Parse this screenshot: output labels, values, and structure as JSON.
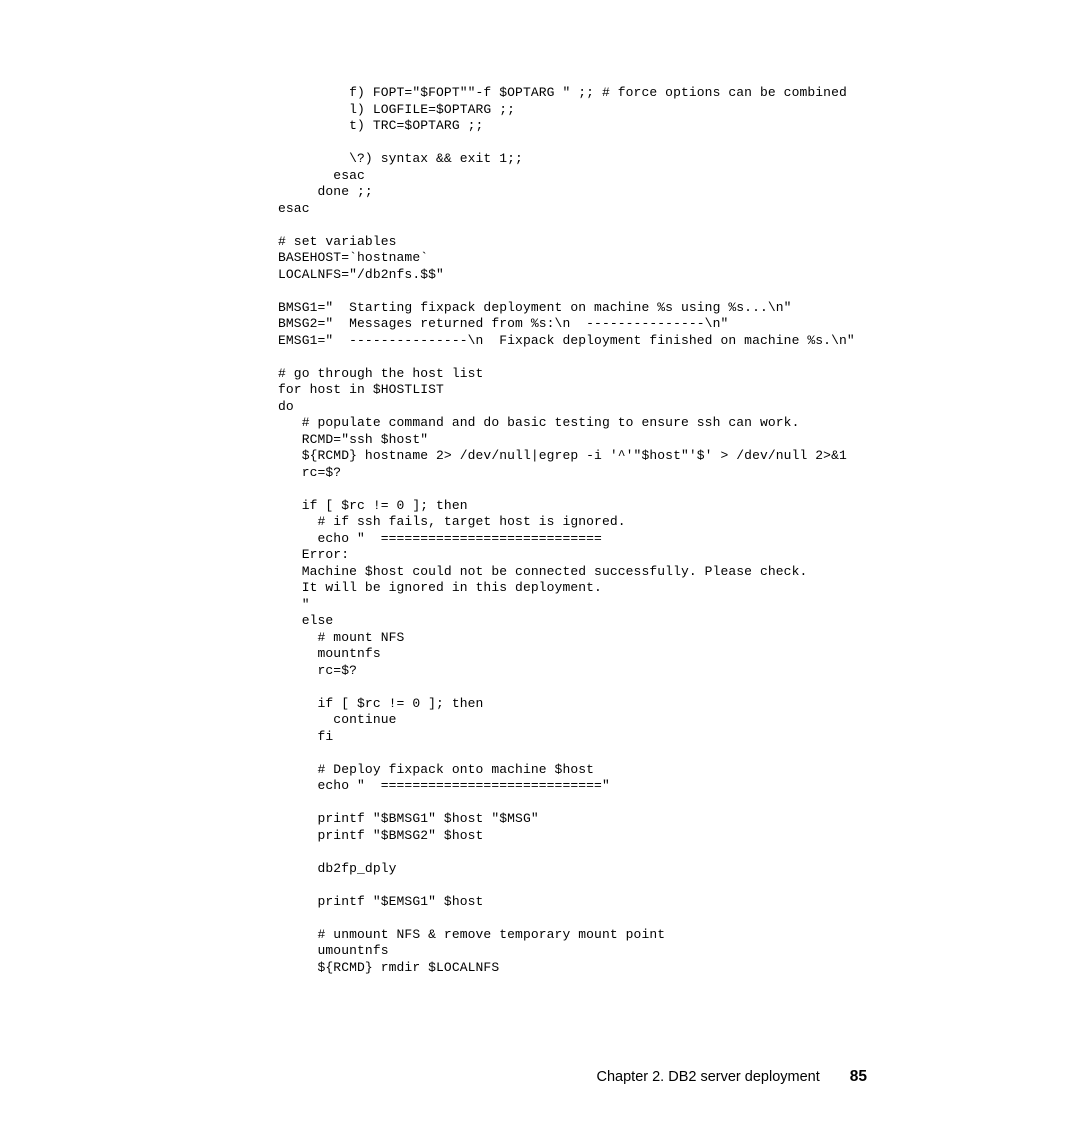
{
  "code": {
    "lines": [
      "         f) FOPT=\"$FOPT\"\"-f $OPTARG \" ;; # force options can be combined",
      "         l) LOGFILE=$OPTARG ;;",
      "         t) TRC=$OPTARG ;;",
      "",
      "         \\?) syntax && exit 1;;",
      "       esac",
      "     done ;;",
      "esac",
      "",
      "# set variables",
      "BASEHOST=`hostname`",
      "LOCALNFS=\"/db2nfs.$$\"",
      "",
      "BMSG1=\"  Starting fixpack deployment on machine %s using %s...\\n\"",
      "BMSG2=\"  Messages returned from %s:\\n  ---------------\\n\"",
      "EMSG1=\"  ---------------\\n  Fixpack deployment finished on machine %s.\\n\"",
      "",
      "# go through the host list",
      "for host in $HOSTLIST",
      "do",
      "   # populate command and do basic testing to ensure ssh can work.",
      "   RCMD=\"ssh $host\"",
      "   ${RCMD} hostname 2> /dev/null|egrep -i '^'\"$host\"'$' > /dev/null 2>&1",
      "   rc=$?",
      "",
      "   if [ $rc != 0 ]; then",
      "     # if ssh fails, target host is ignored.",
      "     echo \"  ============================",
      "   Error:",
      "   Machine $host could not be connected successfully. Please check.",
      "   It will be ignored in this deployment.",
      "   \"",
      "   else",
      "     # mount NFS",
      "     mountnfs",
      "     rc=$?",
      "",
      "     if [ $rc != 0 ]; then",
      "       continue",
      "     fi",
      "",
      "     # Deploy fixpack onto machine $host",
      "     echo \"  ============================\"",
      "",
      "     printf \"$BMSG1\" $host \"$MSG\"",
      "     printf \"$BMSG2\" $host",
      "",
      "     db2fp_dply",
      "",
      "     printf \"$EMSG1\" $host",
      "",
      "     # unmount NFS & remove temporary mount point",
      "     umountnfs",
      "     ${RCMD} rmdir $LOCALNFS"
    ]
  },
  "footer": {
    "chapter_text": "Chapter 2. DB2 server deployment",
    "page_number": "85"
  }
}
